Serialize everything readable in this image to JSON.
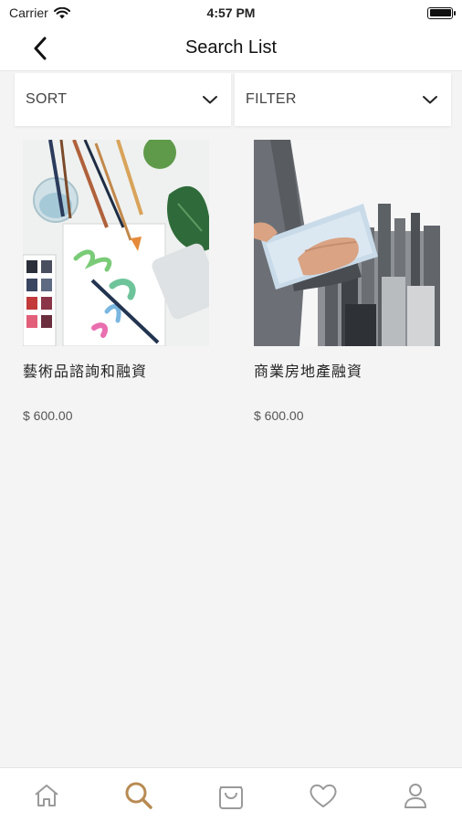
{
  "status_bar": {
    "carrier": "Carrier",
    "time": "4:57 PM"
  },
  "nav": {
    "title": "Search List",
    "back_icon": "chevron-left-icon"
  },
  "controls": {
    "sort_label": "SORT",
    "filter_label": "FILTER"
  },
  "products": [
    {
      "name": "藝術品諮詢和融資",
      "price": "$ 600.00",
      "image": "art-supplies-image"
    },
    {
      "name": "商業房地產融資",
      "price": "$ 600.00",
      "image": "business-tablet-city-image"
    }
  ],
  "tab_bar": {
    "items": [
      {
        "icon": "home-icon",
        "active": false
      },
      {
        "icon": "search-icon",
        "active": true
      },
      {
        "icon": "shopping-bag-icon",
        "active": false
      },
      {
        "icon": "heart-icon",
        "active": false
      },
      {
        "icon": "user-icon",
        "active": false
      }
    ],
    "active_color": "#b88a52",
    "inactive_color": "#9a9a9a"
  }
}
